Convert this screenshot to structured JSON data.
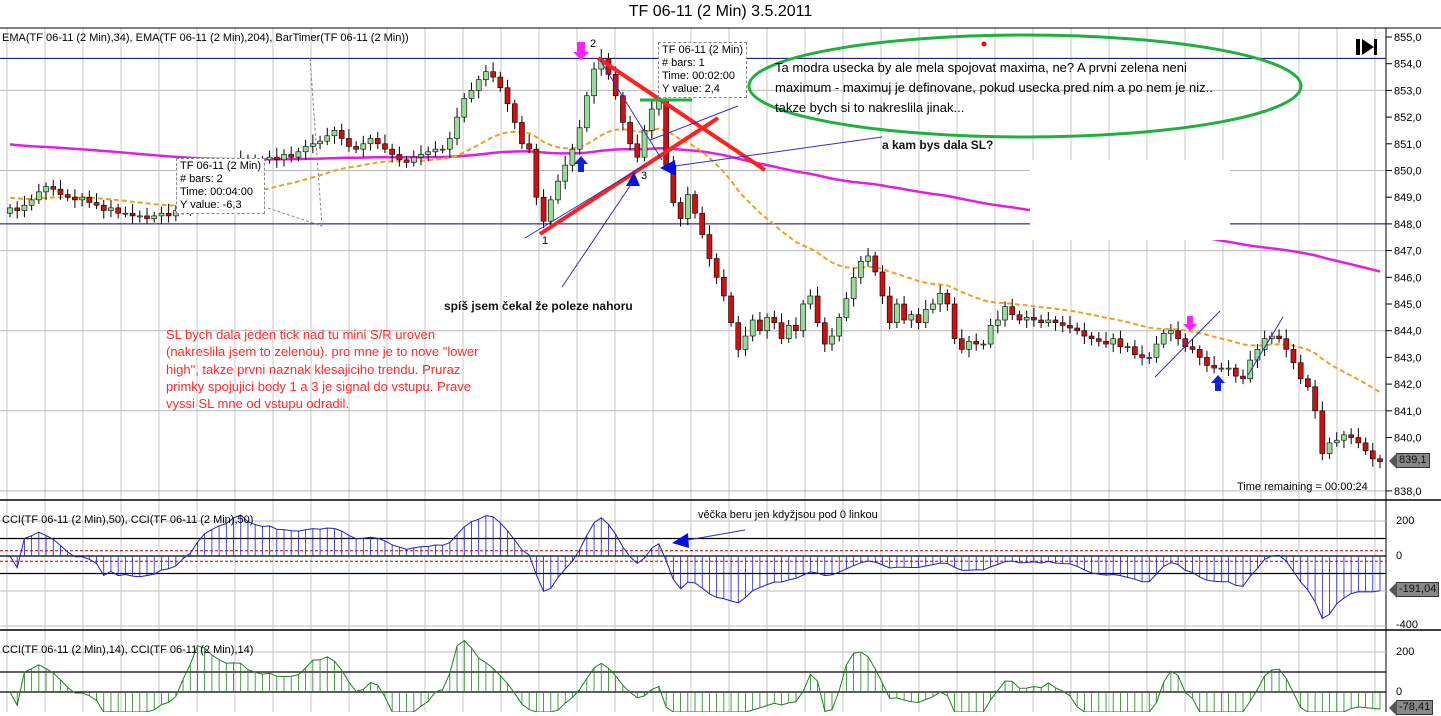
{
  "title": "TF 06-11 (2 Min)  3.5.2011",
  "price_panel_label": "EMA(TF 06-11 (2 Min),34), EMA(TF 06-11 (2 Min),204), BarTimer(TF 06-11 (2 Min))",
  "cci50_panel_label": "CCI(TF 06-11 (2 Min),50), CCI(TF 06-11 (2 Min),50)",
  "cci14_panel_label": "CCI(TF 06-11 (2 Min),14), CCI(TF 06-11 (2 Min),14)",
  "bar_timer": "Time remaining = 00:00:24",
  "price_tag": "839,1",
  "cci50_tag": "-191,04",
  "cci14_tag": "-78,41",
  "tooltip_left": {
    "instrument": "TF 06-11 (2 Min)",
    "bars": "# bars:   2",
    "time": "Time:     00:04:00",
    "yvalue": "Y value: -6,3"
  },
  "tooltip_right": {
    "instrument": "TF 06-11 (2 Min)",
    "bars": "# bars:   1",
    "time": "Time:     00:02:00",
    "yvalue": "Y value: 2,4"
  },
  "point_labels": {
    "p1": "1",
    "p2": "2",
    "p3": "3"
  },
  "annotations": {
    "ellipse_note": "Ta modra usecka by ale mela spojovat maxima, ne? A prvni zelena neni maximum - maximuj je definovane, pokud usecka pred nim a po nem je niz.. takze bych si to nakreslila jinak...",
    "sl_question": "a kam bys dala SL?",
    "expected_up": "spíš jsem čekal že poleze nahoru",
    "red_note": "SL bych dala jeden tick nad tu mini S/R uroven (nakreslila jsem to zelenou). pro mne je to nove \"lower high\", takze prvni naznak klesajiciho trendu. Pruraz primky spojujici body 1 a 3 je signal do vstupu.  Prave vyssi SL mne od vstupu odradil.",
    "cci_note": "věčka beru jen kdyžjsou pod 0 linkou"
  },
  "colors": {
    "up": "#98dc98",
    "down": "#d01010",
    "ema34": "#f0a020",
    "ema204": "#e020e0",
    "cci50": "#2020c0",
    "cci14": "#208020",
    "annot_red": "#ff2020",
    "annot_green": "#20b040",
    "hline": "#000080"
  },
  "icons": [
    "bar-timer-end-icon"
  ],
  "chart_data": {
    "type": "candlestick",
    "title": "TF 06-11 (2 Min)  3.5.2011",
    "ylim": [
      837.5,
      855.5
    ],
    "yticks": [
      "855,0",
      "854,0",
      "853,0",
      "852,0",
      "851,0",
      "850,0",
      "849,0",
      "848,0",
      "847,0",
      "846,0",
      "845,0",
      "844,0",
      "843,0",
      "842,0",
      "841,0",
      "840,0",
      "838,0"
    ],
    "cci50_ticks": [
      "200",
      "0",
      "-400"
    ],
    "cci14_ticks": [
      "200",
      "0"
    ],
    "ema_periods": [
      34,
      204
    ],
    "cci_periods": [
      50,
      14
    ],
    "horizontal_lines": [
      854.2,
      848.0
    ],
    "closes": [
      848.6,
      848.5,
      848.7,
      848.9,
      849.2,
      849.4,
      849.3,
      849.1,
      849.0,
      848.9,
      849.0,
      848.8,
      848.7,
      848.5,
      848.6,
      848.4,
      848.4,
      848.3,
      848.3,
      848.2,
      848.3,
      848.4,
      848.3,
      848.5,
      848.6,
      848.9,
      849.1,
      849.3,
      849.5,
      849.7,
      849.9,
      850.2,
      850.4,
      850.3,
      850.3,
      850.4,
      850.5,
      850.4,
      850.6,
      850.5,
      850.7,
      850.9,
      851.0,
      851.1,
      851.3,
      851.5,
      851.2,
      850.9,
      850.8,
      851.0,
      851.2,
      851.0,
      850.8,
      850.6,
      850.4,
      850.3,
      850.5,
      850.6,
      850.7,
      850.8,
      850.8,
      851.2,
      852.0,
      852.7,
      853.0,
      853.4,
      853.7,
      853.5,
      853.1,
      852.5,
      851.8,
      851.0,
      850.8,
      849.0,
      848.1,
      848.9,
      849.6,
      850.2,
      850.8,
      851.6,
      852.8,
      853.8,
      854.2,
      853.6,
      852.8,
      851.8,
      851.0,
      850.5,
      851.5,
      852.3,
      852.6,
      850.2,
      848.8,
      848.2,
      849.1,
      848.4,
      847.6,
      846.7,
      846.0,
      845.3,
      844.3,
      843.3,
      843.8,
      844.4,
      844.0,
      844.5,
      844.3,
      843.7,
      844.2,
      844.0,
      845.0,
      845.3,
      844.3,
      843.5,
      843.8,
      844.5,
      845.2,
      846.0,
      846.6,
      846.8,
      846.2,
      845.3,
      844.3,
      845.0,
      844.4,
      844.6,
      844.3,
      844.8,
      845.0,
      845.4,
      845.0,
      843.7,
      843.3,
      843.6,
      843.5,
      843.5,
      844.2,
      844.4,
      844.9,
      844.6,
      844.4,
      844.5,
      844.4,
      844.3,
      844.4,
      844.3,
      844.2,
      844.1,
      844.0,
      843.8,
      843.7,
      843.6,
      843.5,
      843.7,
      843.4,
      843.4,
      843.1,
      843.0,
      843.0,
      843.5,
      843.9,
      844.0,
      843.7,
      843.4,
      843.3,
      843.0,
      842.7,
      842.6,
      842.6,
      842.6,
      842.3,
      842.2,
      842.9,
      843.3,
      843.7,
      843.8,
      843.7,
      843.3,
      842.8,
      842.2,
      841.9,
      841.0,
      839.4,
      839.8,
      839.9,
      840.1,
      840.0,
      839.8,
      839.5,
      839.2,
      839.1
    ],
    "first_open": 848.4,
    "ema34_seed": 849.0,
    "ema204_seed": 851.0
  }
}
